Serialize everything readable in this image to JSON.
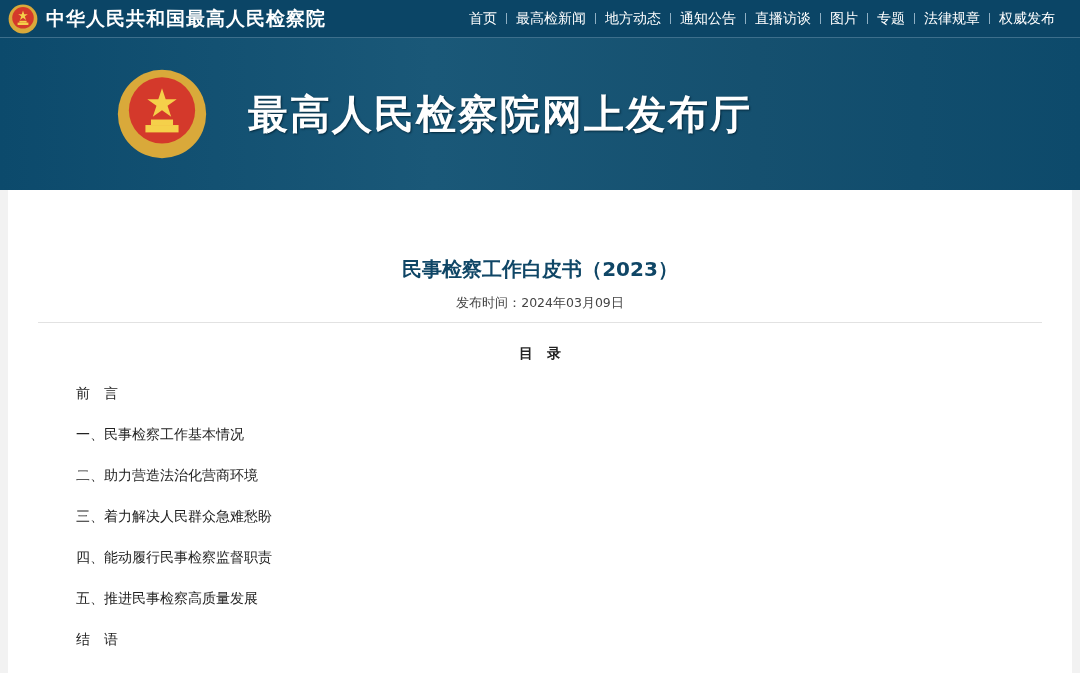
{
  "top_bar": {
    "site_name": "中华人民共和国最高人民检察院",
    "nav": [
      {
        "label": "首页"
      },
      {
        "label": "最高检新闻"
      },
      {
        "label": "地方动态"
      },
      {
        "label": "通知公告"
      },
      {
        "label": "直播访谈"
      },
      {
        "label": "图片"
      },
      {
        "label": "专题"
      },
      {
        "label": "法律规章"
      },
      {
        "label": "权威发布"
      }
    ]
  },
  "banner": {
    "title": "最高人民检察院网上发布厅"
  },
  "article": {
    "title": "民事检察工作白皮书（2023）",
    "date_label": "发布时间：",
    "date": "2024年03月09日",
    "toc_heading": "目　录",
    "toc": [
      "前　言",
      "一、民事检察工作基本情况",
      "二、助力营造法治化营商环境",
      "三、着力解决人民群众急难愁盼",
      "四、能动履行民事检察监督职责",
      "五、推进民事检察高质量发展",
      "结　语"
    ]
  }
}
